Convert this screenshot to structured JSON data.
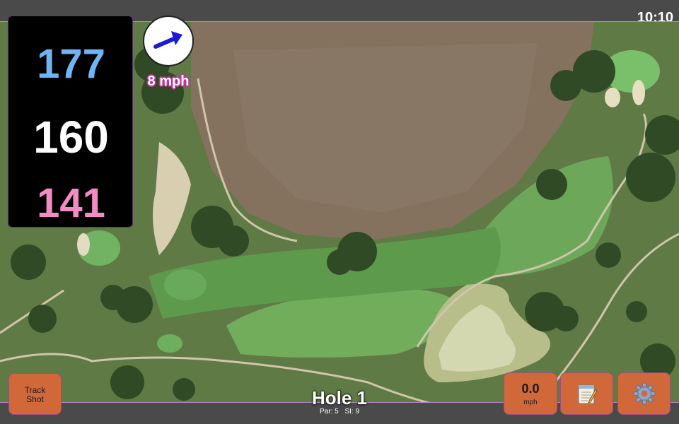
{
  "status_bar": {
    "time": "10:10"
  },
  "distances": {
    "back": "177",
    "center": "160",
    "front": "141"
  },
  "wind": {
    "speed": "8 mph",
    "icon": "arrow-icon",
    "arrow_color": "#1a1ad8"
  },
  "hole": {
    "title": "Hole 1",
    "par": "Par: 5",
    "si": "SI: 9"
  },
  "buttons": {
    "track_shot_line1": "Track",
    "track_shot_line2": "Shot",
    "speed_value": "0.0",
    "speed_unit": "mph",
    "notes_icon": "notepad-icon",
    "settings_icon": "gear-icon"
  },
  "colors": {
    "back_distance": "#6fb4f4",
    "center_distance": "#ffffff",
    "front_distance": "#f58bc5",
    "button": "#d0683a"
  }
}
